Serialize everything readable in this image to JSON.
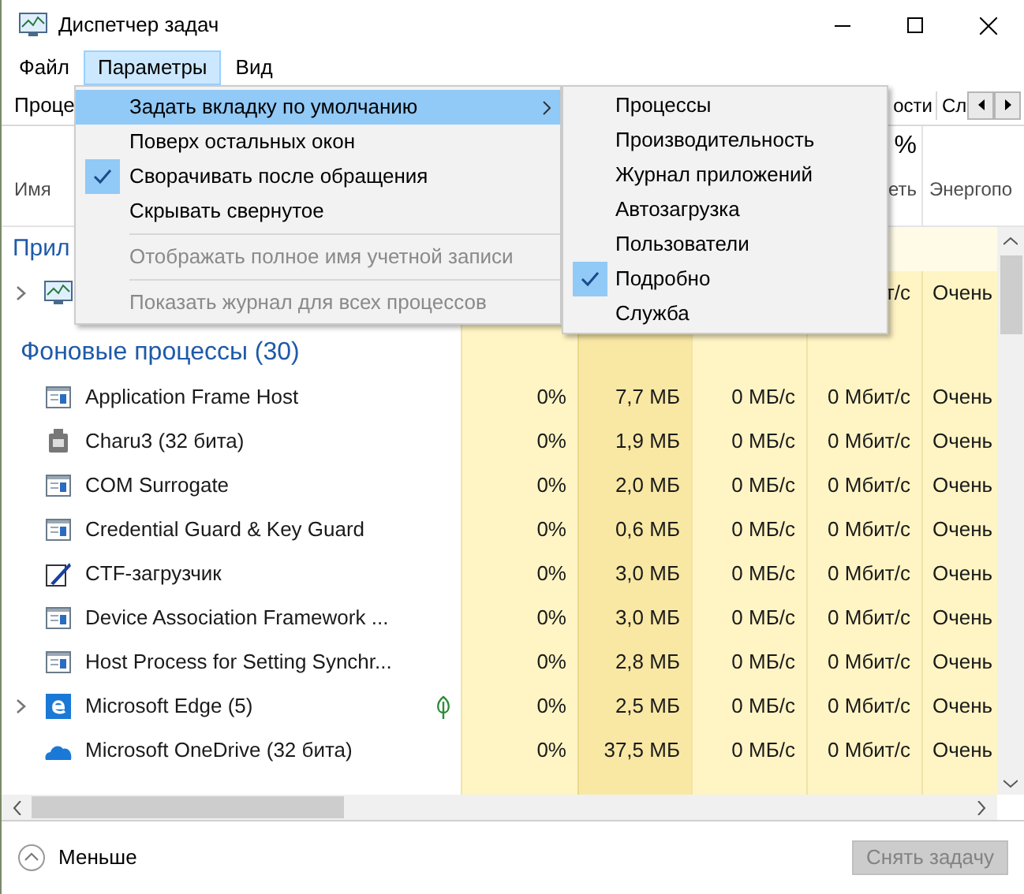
{
  "window": {
    "title": "Диспетчер задач"
  },
  "menu": [
    {
      "label": "Файл",
      "selected": false
    },
    {
      "label": "Параметры",
      "selected": true
    },
    {
      "label": "Вид",
      "selected": false
    }
  ],
  "tabs": [
    {
      "label": "Проце"
    },
    {
      "label": "ости"
    },
    {
      "label": "Сл"
    }
  ],
  "header": {
    "column_1": "Имя",
    "column_5_top": "%",
    "column_5": "еть",
    "column_6": "Энергопо"
  },
  "app_group": {
    "title": "Прил",
    "rows": [
      {
        "kind": "monitor",
        "expandable": true,
        "network": "т/с",
        "energy": "Очень"
      }
    ]
  },
  "background_group": {
    "title": "Фоновые процессы (30)",
    "rows": [
      {
        "name": "Application Frame Host",
        "kind": "window",
        "expandable": false,
        "eco": false,
        "cpu": "0%",
        "memory": "7,7 МБ",
        "disk": "0 МБ/с",
        "network": "0 Мбит/с",
        "energy": "Очень"
      },
      {
        "name": "Charu3 (32 бита)",
        "kind": "app",
        "expandable": false,
        "eco": false,
        "cpu": "0%",
        "memory": "1,9 МБ",
        "disk": "0 МБ/с",
        "network": "0 Мбит/с",
        "energy": "Очень"
      },
      {
        "name": "COM Surrogate",
        "kind": "window",
        "expandable": false,
        "eco": false,
        "cpu": "0%",
        "memory": "2,0 МБ",
        "disk": "0 МБ/с",
        "network": "0 Мбит/с",
        "energy": "Очень"
      },
      {
        "name": "Credential Guard & Key Guard",
        "kind": "window",
        "expandable": false,
        "eco": false,
        "cpu": "0%",
        "memory": "0,6 МБ",
        "disk": "0 МБ/с",
        "network": "0 Мбит/с",
        "energy": "Очень"
      },
      {
        "name": "CTF-загрузчик",
        "kind": "pen",
        "expandable": false,
        "eco": false,
        "cpu": "0%",
        "memory": "3,0 МБ",
        "disk": "0 МБ/с",
        "network": "0 Мбит/с",
        "energy": "Очень"
      },
      {
        "name": "Device Association Framework ...",
        "kind": "window",
        "expandable": false,
        "eco": false,
        "cpu": "0%",
        "memory": "3,0 МБ",
        "disk": "0 МБ/с",
        "network": "0 Мбит/с",
        "energy": "Очень"
      },
      {
        "name": "Host Process for Setting Synchr...",
        "kind": "window",
        "expandable": false,
        "eco": false,
        "cpu": "0%",
        "memory": "2,8 МБ",
        "disk": "0 МБ/с",
        "network": "0 Мбит/с",
        "energy": "Очень"
      },
      {
        "name": "Microsoft Edge (5)",
        "kind": "browser",
        "expandable": true,
        "eco": true,
        "cpu": "0%",
        "memory": "2,5 МБ",
        "disk": "0 МБ/с",
        "network": "0 Мбит/с",
        "energy": "Очень"
      },
      {
        "name": "Microsoft OneDrive (32 бита)",
        "kind": "cloud",
        "expandable": false,
        "eco": false,
        "cpu": "0%",
        "memory": "37,5 МБ",
        "disk": "0 МБ/с",
        "network": "0 Мбит/с",
        "energy": "Очень"
      }
    ]
  },
  "options_menu": [
    {
      "kind": "item",
      "label": "Задать вкладку по умолчанию",
      "selected": true,
      "submenu": true,
      "checked": false,
      "disabled": false
    },
    {
      "kind": "item",
      "label": "Поверх остальных окон",
      "selected": false,
      "submenu": false,
      "checked": false,
      "disabled": false
    },
    {
      "kind": "item",
      "label": "Сворачивать после обращения",
      "selected": false,
      "submenu": false,
      "checked": true,
      "disabled": false
    },
    {
      "kind": "item",
      "label": "Скрывать свернутое",
      "selected": false,
      "submenu": false,
      "checked": false,
      "disabled": false
    },
    {
      "kind": "separator"
    },
    {
      "kind": "item",
      "label": "Отображать полное имя учетной записи",
      "selected": false,
      "submenu": false,
      "checked": false,
      "disabled": true
    },
    {
      "kind": "separator"
    },
    {
      "kind": "item",
      "label": "Показать журнал для всех процессов",
      "selected": false,
      "submenu": false,
      "checked": false,
      "disabled": true
    }
  ],
  "default_tab_menu": [
    {
      "label": "Процессы",
      "checked": false
    },
    {
      "label": "Производительность",
      "checked": false
    },
    {
      "label": "Журнал приложений",
      "checked": false
    },
    {
      "label": "Автозагрузка",
      "checked": false
    },
    {
      "label": "Пользователи",
      "checked": false
    },
    {
      "label": "Подробно",
      "checked": true
    },
    {
      "label": "Служба",
      "checked": false
    }
  ],
  "footer": {
    "less": "Меньше",
    "end_task": {
      "label": "Снять задачу",
      "disabled": true
    }
  }
}
